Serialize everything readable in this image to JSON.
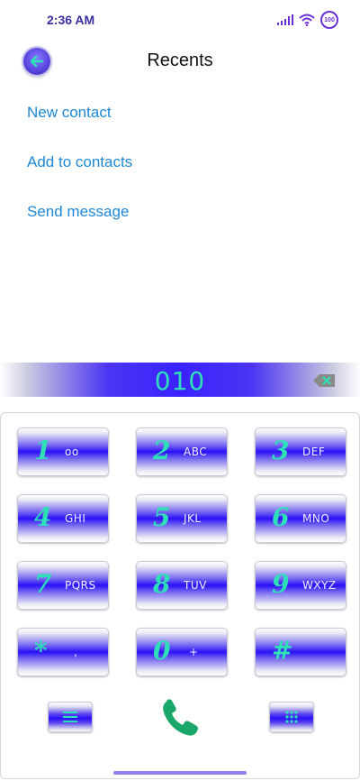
{
  "status_bar": {
    "time": "2:36 AM",
    "battery": "100"
  },
  "header": {
    "title": "Recents"
  },
  "actions": {
    "new_contact": "New contact",
    "add_to_contacts": "Add to contacts",
    "send_message": "Send message"
  },
  "dialer": {
    "number": "010"
  },
  "keys": [
    {
      "digit": "1",
      "letters": "oo"
    },
    {
      "digit": "2",
      "letters": "ABC"
    },
    {
      "digit": "3",
      "letters": "DEF"
    },
    {
      "digit": "4",
      "letters": "GHI"
    },
    {
      "digit": "5",
      "letters": "JKL"
    },
    {
      "digit": "6",
      "letters": "MNO"
    },
    {
      "digit": "7",
      "letters": "PQRS"
    },
    {
      "digit": "8",
      "letters": "TUV"
    },
    {
      "digit": "9",
      "letters": "WXYZ"
    },
    {
      "digit": "*",
      "letters": ","
    },
    {
      "digit": "0",
      "letters": "+"
    },
    {
      "digit": "#",
      "letters": ""
    }
  ],
  "icons": {
    "back": "back-arrow-icon",
    "backspace": "backspace-icon",
    "menu": "menu-icon",
    "call": "phone-icon",
    "dialpad": "dialpad-icon"
  },
  "colors": {
    "accent": "#2de0b8",
    "key_blue": "#2a10f8",
    "link": "#1e88d6",
    "call_green": "#1aa86a"
  }
}
